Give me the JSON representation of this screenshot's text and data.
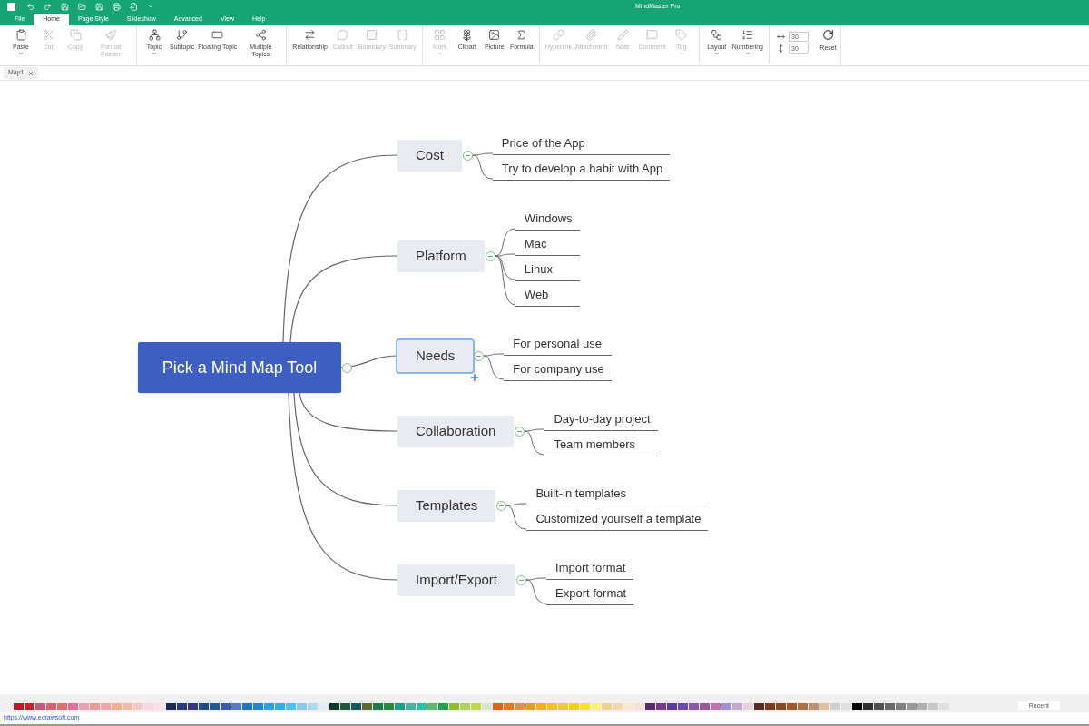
{
  "window": {
    "title": "MindMaster Pro"
  },
  "ribbon_tabs": [
    {
      "label": "File",
      "selected": false
    },
    {
      "label": "Home",
      "selected": true
    },
    {
      "label": "Page Style",
      "selected": false
    },
    {
      "label": "Slideshow",
      "selected": false
    },
    {
      "label": "Advanced",
      "selected": false
    },
    {
      "label": "View",
      "selected": false
    },
    {
      "label": "Help",
      "selected": false
    }
  ],
  "toolbar": {
    "groups": [
      {
        "buttons": [
          {
            "kind": "paste",
            "label": "Paste",
            "disabled": false,
            "dropdown": true
          },
          {
            "kind": "cut",
            "label": "Cut",
            "disabled": true,
            "dropdown": false
          },
          {
            "kind": "copy",
            "label": "Copy",
            "disabled": true,
            "dropdown": false
          },
          {
            "kind": "brush",
            "label": "Format Painter",
            "disabled": true,
            "dropdown": false
          }
        ]
      },
      {
        "buttons": [
          {
            "kind": "topic",
            "label": "Topic",
            "disabled": false,
            "dropdown": true
          },
          {
            "kind": "subtopic",
            "label": "Subtopic",
            "disabled": false,
            "dropdown": false
          },
          {
            "kind": "floating",
            "label": "Floating Topic",
            "disabled": false,
            "dropdown": false
          },
          {
            "kind": "multiple",
            "label": "Multiple Topics",
            "disabled": false,
            "dropdown": false
          }
        ]
      },
      {
        "buttons": [
          {
            "kind": "relationship",
            "label": "Relationship",
            "disabled": false,
            "dropdown": false
          },
          {
            "kind": "callout",
            "label": "Callout",
            "disabled": true,
            "dropdown": false
          },
          {
            "kind": "boundary",
            "label": "Boundary",
            "disabled": true,
            "dropdown": false
          },
          {
            "kind": "summary",
            "label": "Summary",
            "disabled": true,
            "dropdown": false
          }
        ]
      },
      {
        "buttons": [
          {
            "kind": "mark",
            "label": "Mark",
            "disabled": true,
            "dropdown": true
          },
          {
            "kind": "clipart",
            "label": "Clipart",
            "disabled": false,
            "dropdown": false
          },
          {
            "kind": "picture",
            "label": "Picture",
            "disabled": false,
            "dropdown": false
          },
          {
            "kind": "formula",
            "label": "Formula",
            "disabled": false,
            "dropdown": false
          }
        ]
      },
      {
        "buttons": [
          {
            "kind": "hyperlink",
            "label": "Hyperlink",
            "disabled": true,
            "dropdown": false
          },
          {
            "kind": "attachment",
            "label": "Attachment",
            "disabled": true,
            "dropdown": false
          },
          {
            "kind": "note",
            "label": "Note",
            "disabled": true,
            "dropdown": false
          },
          {
            "kind": "comment",
            "label": "Comment",
            "disabled": true,
            "dropdown": false
          },
          {
            "kind": "tag",
            "label": "Tag",
            "disabled": true,
            "dropdown": true
          }
        ]
      },
      {
        "buttons": [
          {
            "kind": "layout",
            "label": "Layout",
            "disabled": false,
            "dropdown": true
          },
          {
            "kind": "numbering",
            "label": "Numbering",
            "disabled": false,
            "dropdown": true
          }
        ]
      }
    ],
    "spacing_fields": [
      {
        "kind": "horizontal",
        "value": "30"
      },
      {
        "kind": "vertical",
        "value": "30"
      }
    ],
    "reset": {
      "label": "Reset"
    }
  },
  "document_tabs": [
    {
      "label": "Map1",
      "selected": true
    }
  ],
  "map": {
    "central_topic": {
      "label": "Pick a Mind Map Tool",
      "collapsed": false
    },
    "topics": [
      {
        "label": "Cost",
        "selected": false,
        "collapsed": false,
        "subtopics": [
          "Price of the App",
          "Try to develop a habit with App"
        ]
      },
      {
        "label": "Platform",
        "selected": false,
        "collapsed": false,
        "subtopics": [
          "Windows",
          "Mac",
          "Linux",
          "Web"
        ]
      },
      {
        "label": "Needs",
        "selected": true,
        "collapsed": false,
        "subtopics": [
          "For personal use",
          "For company use"
        ]
      },
      {
        "label": "Collaboration",
        "selected": false,
        "collapsed": false,
        "subtopics": [
          "Day-to-day project",
          "Team members"
        ]
      },
      {
        "label": "Templates",
        "selected": false,
        "collapsed": false,
        "subtopics": [
          "Built-in templates",
          "Customized yourself a template"
        ]
      },
      {
        "label": "Import/Export",
        "selected": false,
        "collapsed": false,
        "subtopics": [
          "Import format",
          "Export format"
        ]
      }
    ]
  },
  "palette": {
    "swatches": [
      {
        "color": "#b31b2a"
      },
      {
        "color": "#c4202e"
      },
      {
        "color": "#c75a7a"
      },
      {
        "color": "#d9606e"
      },
      {
        "color": "#e07070"
      },
      {
        "color": "#e0709a"
      },
      {
        "color": "#eaa0b0"
      },
      {
        "color": "#eb9a9a"
      },
      {
        "color": "#f0a8b0"
      },
      {
        "color": "#f2b090"
      },
      {
        "color": "#f0b8a8"
      },
      {
        "color": "#f5c8c8"
      },
      {
        "color": "#f8d8e0"
      },
      {
        "color": "#fbe0e8"
      },
      {
        "color": "#1a2a55"
      },
      {
        "color": "#2a3a7a"
      },
      {
        "color": "#3a3580"
      },
      {
        "color": "#1e4a8a"
      },
      {
        "color": "#1f5a9a"
      },
      {
        "color": "#3a5aa8"
      },
      {
        "color": "#5a7ac0"
      },
      {
        "color": "#1a78c0"
      },
      {
        "color": "#2088d0"
      },
      {
        "color": "#30a0e0"
      },
      {
        "color": "#30b0e8"
      },
      {
        "color": "#50c0f0"
      },
      {
        "color": "#90c8e8"
      },
      {
        "color": "#b0d8f0"
      },
      {
        "color": "#e0eef8"
      },
      {
        "color": "#0d3a2a"
      },
      {
        "color": "#1a5a3a"
      },
      {
        "color": "#1a5a5a"
      },
      {
        "color": "#5a6a30"
      },
      {
        "color": "#1a7a4a"
      },
      {
        "color": "#2a8a3a"
      },
      {
        "color": "#1aa08a"
      },
      {
        "color": "#50b0a0"
      },
      {
        "color": "#30c0a0"
      },
      {
        "color": "#60b870"
      },
      {
        "color": "#20a050"
      },
      {
        "color": "#90c030"
      },
      {
        "color": "#b0d060"
      },
      {
        "color": "#c0d850"
      },
      {
        "color": "#d8e8c8"
      },
      {
        "color": "#e06020"
      },
      {
        "color": "#e07a20"
      },
      {
        "color": "#e09050"
      },
      {
        "color": "#e0a020"
      },
      {
        "color": "#f0b020"
      },
      {
        "color": "#f0c030"
      },
      {
        "color": "#f0c840"
      },
      {
        "color": "#f0d020"
      },
      {
        "color": "#f8e030"
      },
      {
        "color": "#f8f080"
      },
      {
        "color": "#f0d090"
      },
      {
        "color": "#f0d8b0"
      },
      {
        "color": "#f8e8d0"
      },
      {
        "color": "#f8e0d8"
      },
      {
        "color": "#5a2a6a"
      },
      {
        "color": "#7a3a8a"
      },
      {
        "color": "#5a3a9a"
      },
      {
        "color": "#6a4aa8"
      },
      {
        "color": "#8a5aa8"
      },
      {
        "color": "#9a5a9a"
      },
      {
        "color": "#c070b0"
      },
      {
        "color": "#a090d0"
      },
      {
        "color": "#c0a8d0"
      },
      {
        "color": "#e8d0e0"
      },
      {
        "color": "#5a2a1a"
      },
      {
        "color": "#7a3a20"
      },
      {
        "color": "#8a4a20"
      },
      {
        "color": "#a05a2a"
      },
      {
        "color": "#b07040"
      },
      {
        "color": "#c09070"
      },
      {
        "color": "#e0c0a0"
      },
      {
        "color": "#d0d0d0"
      },
      {
        "color": "#e0e0e0"
      },
      {
        "color": "#000000"
      },
      {
        "color": "#303030"
      },
      {
        "color": "#505050"
      },
      {
        "color": "#686868"
      },
      {
        "color": "#808080"
      },
      {
        "color": "#989898"
      },
      {
        "color": "#b0b0b0"
      },
      {
        "color": "#c8c8c8"
      },
      {
        "color": "#e0e0e0"
      }
    ],
    "recent": {
      "label": "Recent"
    }
  },
  "status_bar": {
    "link": "https://www.edrawsoft.com"
  }
}
